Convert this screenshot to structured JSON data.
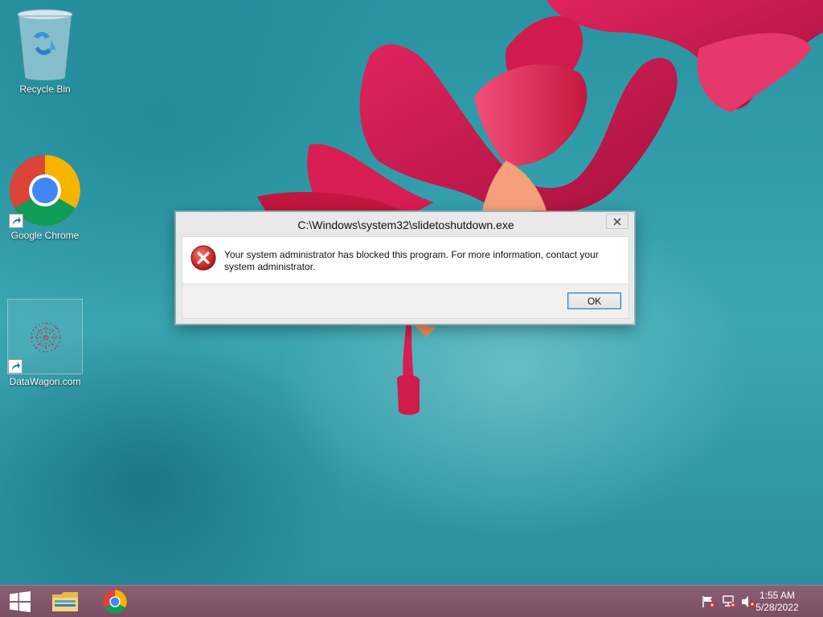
{
  "desktop": {
    "icons": [
      {
        "label": "Recycle Bin"
      },
      {
        "label": "Google Chrome"
      },
      {
        "label": "DataWagon.com"
      }
    ]
  },
  "dialog": {
    "title": "C:\\Windows\\system32\\slidetoshutdown.exe",
    "message": "Your system administrator has blocked this program. For more information, contact your system administrator.",
    "ok_label": "OK",
    "icon": "error-icon"
  },
  "taskbar": {
    "apps": [
      "file-explorer-icon",
      "chrome-icon"
    ],
    "tray": [
      "action-center-flag-icon",
      "network-icon",
      "volume-muted-icon"
    ],
    "time": "1:55 AM",
    "date": "5/28/2022"
  },
  "colors": {
    "taskbar": "#7f5368",
    "ok_border": "#3c7fb1",
    "error_red": "#d32f2f"
  }
}
